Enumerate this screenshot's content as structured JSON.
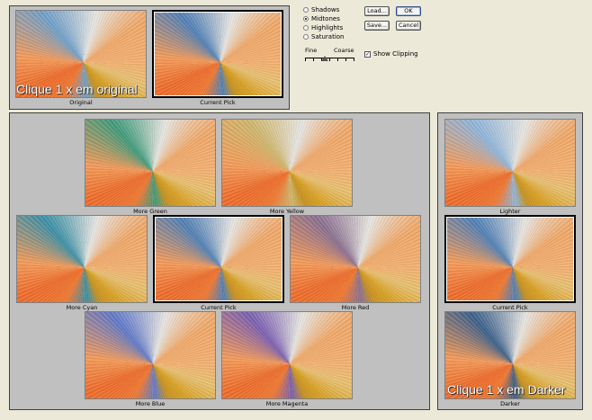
{
  "top": {
    "original_caption": "Original",
    "current_caption": "Current Pick",
    "annotation": "Clique 1 x em original"
  },
  "options": {
    "tones": [
      {
        "label": "Shadows",
        "selected": false
      },
      {
        "label": "Midtones",
        "selected": true
      },
      {
        "label": "Highlights",
        "selected": false
      },
      {
        "label": "Saturation",
        "selected": false
      }
    ],
    "slider_fine": "Fine",
    "slider_coarse": "Coarse",
    "slider_value": 0.4,
    "show_clipping_label": "Show Clipping",
    "show_clipping_checked": true,
    "load_button": "Load...",
    "save_button": "Save...",
    "ok_button": "OK",
    "cancel_button": "Cancel"
  },
  "variations": {
    "more_green": "More Green",
    "more_yellow": "More Yellow",
    "more_cyan": "More Cyan",
    "current_pick": "Current Pick",
    "more_red": "More Red",
    "more_blue": "More Blue",
    "more_magenta": "More Magenta"
  },
  "brightness": {
    "lighter": "Lighter",
    "current_pick": "Current Pick",
    "darker": "Darker",
    "annotation": "Clique 1 x em Darker"
  },
  "tints": {
    "original": "#6f9fc9",
    "current": "#4f7fb5",
    "more_green": "#3e9a7a",
    "more_yellow": "#cfb66c",
    "more_cyan": "#3a8fa6",
    "more_red": "#8a6f8f",
    "more_blue": "#5f78c8",
    "more_magenta": "#7a5fb0",
    "lighter": "#8fb4da",
    "darker": "#3a5f8a"
  }
}
